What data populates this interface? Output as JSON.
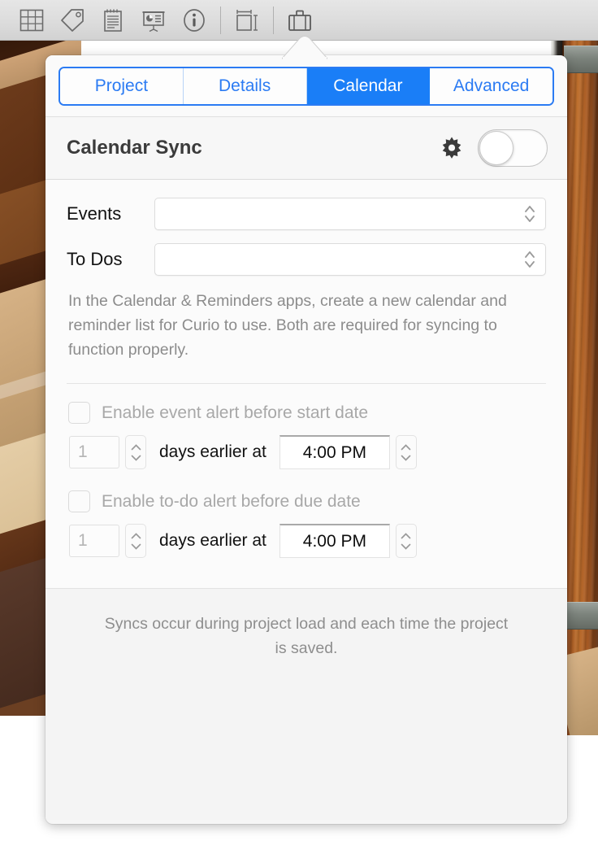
{
  "toolbar": {
    "items": [
      {
        "name": "grid-icon",
        "label": "Grid"
      },
      {
        "name": "tag-icon",
        "label": "Tag"
      },
      {
        "name": "notepad-icon",
        "label": "Notes"
      },
      {
        "name": "presentation-icon",
        "label": "Presentation"
      },
      {
        "name": "info-icon",
        "label": "Info"
      },
      {
        "name": "dimensions-icon",
        "label": "Dimensions"
      },
      {
        "name": "briefcase-icon",
        "label": "Project"
      }
    ]
  },
  "popover": {
    "tabs": [
      {
        "label": "Project",
        "active": false
      },
      {
        "label": "Details",
        "active": false
      },
      {
        "label": "Calendar",
        "active": true
      },
      {
        "label": "Advanced",
        "active": false
      }
    ],
    "header": {
      "title": "Calendar Sync",
      "gear_icon": "gear-icon",
      "toggle_state": "off"
    },
    "fields": [
      {
        "label": "Events",
        "value": "",
        "placeholder": ""
      },
      {
        "label": "To Dos",
        "value": "",
        "placeholder": ""
      }
    ],
    "help_text": "In the Calendar & Reminders apps, create a new calendar and reminder list for Curio to use. Both are required for syncing to function properly.",
    "alerts": [
      {
        "checkbox_label": "Enable event alert before start date",
        "checked": false,
        "enabled": false,
        "days_value": "1",
        "middle_text": "days earlier at",
        "time_value": "4:00 PM"
      },
      {
        "checkbox_label": "Enable to-do alert before due date",
        "checked": false,
        "enabled": false,
        "days_value": "1",
        "middle_text": "days earlier at",
        "time_value": "4:00 PM"
      }
    ],
    "footer_text": "Syncs occur during project load and each time the project is saved."
  },
  "colors": {
    "accent_blue": "#1a7ef7",
    "tab_border_blue": "#2b7bf3",
    "tab_text_blue": "#2b7bf3",
    "title_gray": "#3b3b3b",
    "help_gray": "#8c8c8c",
    "disabled_gray": "#a8a8a8",
    "popover_bg": "#f6f6f6",
    "toolbar_bg": "#dcdcdc"
  }
}
